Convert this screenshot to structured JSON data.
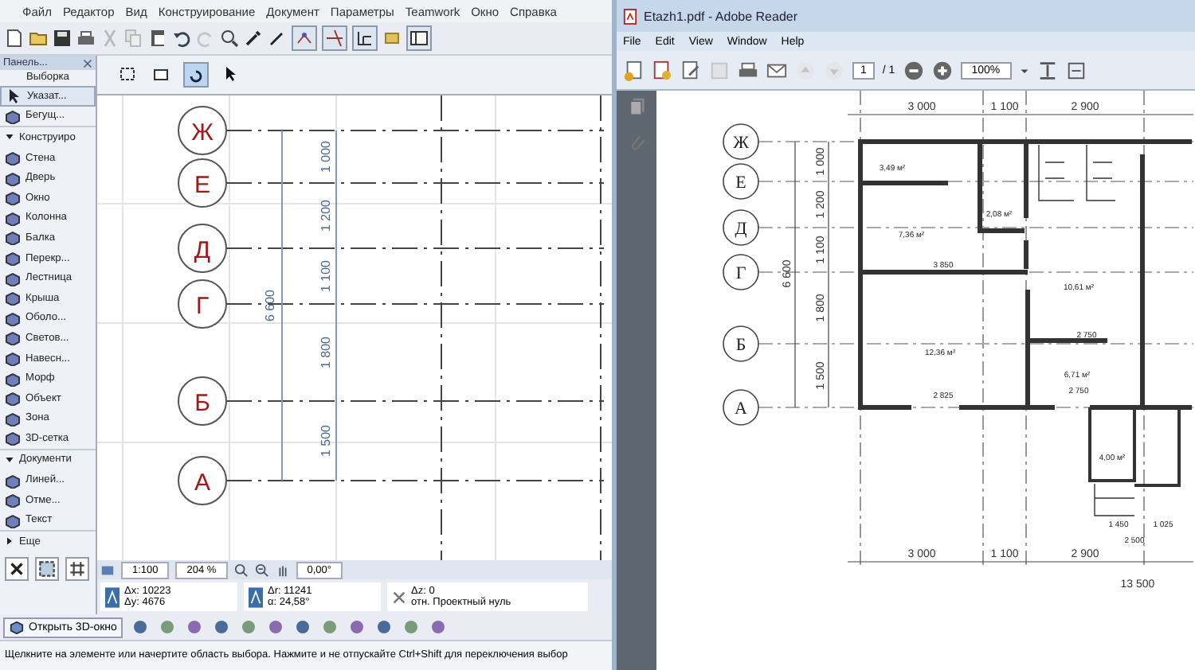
{
  "archicad": {
    "menu": [
      "Файл",
      "Редактор",
      "Вид",
      "Конструирование",
      "Документ",
      "Параметры",
      "Teamwork",
      "Окно",
      "Справка"
    ],
    "palette": {
      "title": "Панель...",
      "mode": "Выборка",
      "items": [
        {
          "kind": "tool",
          "label": "Указат...",
          "selected": true
        },
        {
          "kind": "tool",
          "label": "Бегущ...",
          "selected": false
        },
        {
          "kind": "section",
          "label": "Конструиро",
          "expanded": true,
          "selected": false
        },
        {
          "kind": "tool",
          "label": "Стена",
          "selected": false
        },
        {
          "kind": "tool",
          "label": "Дверь",
          "selected": false
        },
        {
          "kind": "tool",
          "label": "Окно",
          "selected": false
        },
        {
          "kind": "tool",
          "label": "Колонна",
          "selected": false
        },
        {
          "kind": "tool",
          "label": "Балка",
          "selected": false
        },
        {
          "kind": "tool",
          "label": "Перекр...",
          "selected": false
        },
        {
          "kind": "tool",
          "label": "Лестница",
          "selected": false
        },
        {
          "kind": "tool",
          "label": "Крыша",
          "selected": false
        },
        {
          "kind": "tool",
          "label": "Оболо...",
          "selected": false
        },
        {
          "kind": "tool",
          "label": "Светов...",
          "selected": false
        },
        {
          "kind": "tool",
          "label": "Навесн...",
          "selected": false
        },
        {
          "kind": "tool",
          "label": "Морф",
          "selected": false
        },
        {
          "kind": "tool",
          "label": "Объект",
          "selected": false
        },
        {
          "kind": "tool",
          "label": "Зона",
          "selected": false
        },
        {
          "kind": "tool",
          "label": "3D-сетка",
          "selected": false
        },
        {
          "kind": "section",
          "label": "Документи",
          "expanded": true,
          "selected": false
        },
        {
          "kind": "tool",
          "label": "Линей...",
          "selected": false
        },
        {
          "kind": "tool",
          "label": "Отме...",
          "selected": false
        },
        {
          "kind": "tool",
          "label": "Текст",
          "selected": false
        },
        {
          "kind": "section",
          "label": "Еще",
          "expanded": false,
          "selected": false
        }
      ]
    },
    "axes": [
      "Ж",
      "Е",
      "Д",
      "Г",
      "Б",
      "А"
    ],
    "dims": [
      "1 000",
      "1 200",
      "1 100",
      "1 800",
      "1 500"
    ],
    "total": "6 600",
    "nav": {
      "scale": "1:100",
      "zoom": "204 %",
      "angle": "0,00°"
    },
    "coords": {
      "dx": "Δx: 10223",
      "dy": "Δy: 4676",
      "dr": "Δr: 11241",
      "angle": "α: 24,58°",
      "dz": "Δz: 0",
      "ref": "отн. Проектный нуль"
    },
    "open_3d": "Открыть 3D-окно",
    "status": "Щелкните на элементе или начертите область выбора. Нажмите и не отпускайте Ctrl+Shift для переключения выбор"
  },
  "reader": {
    "title": "Etazh1.pdf - Adobe Reader",
    "menu": [
      "File",
      "Edit",
      "View",
      "Window",
      "Help"
    ],
    "page": "1",
    "pages": "/ 1",
    "zoom": "100%",
    "plan": {
      "axes": [
        "Ж",
        "Е",
        "Д",
        "Г",
        "Б",
        "А"
      ],
      "dims": [
        "1 000",
        "1 200",
        "1 100",
        "1 800",
        "1 500"
      ],
      "total": "6 600",
      "top_dims": [
        "3 000",
        "1 100",
        "2 900"
      ],
      "bottom_dims": [
        "3 000",
        "1 100",
        "2 900"
      ],
      "overall": "13 500",
      "rooms": [
        "3,49 м²",
        "7,36 м²",
        "2,08 м²",
        "10,61 м²",
        "12,36 м²",
        "6,71 м²",
        "4,00 м²"
      ],
      "room_dims": [
        "3 850",
        "2 750",
        "2 825",
        "2 750",
        "1 450",
        "1 025",
        "2 500"
      ]
    }
  }
}
